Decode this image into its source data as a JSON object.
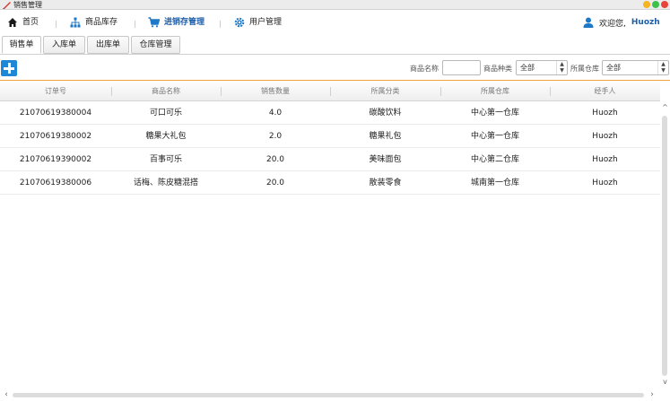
{
  "window": {
    "title": "销售管理",
    "controls": [
      "minimize",
      "maximize",
      "close"
    ],
    "control_colors": [
      "#f5b51e",
      "#3cc24a",
      "#e8443a"
    ]
  },
  "navbar": {
    "items": [
      {
        "label": "首页",
        "icon": "home-icon"
      },
      {
        "label": "商品库存",
        "icon": "sitemap-icon"
      },
      {
        "label": "进销存管理",
        "icon": "cart-icon",
        "active": true
      },
      {
        "label": "用户管理",
        "icon": "gear-icon"
      }
    ],
    "welcome_text": "欢迎您,",
    "username": "Huozh",
    "accent_color": "#1f5ea8"
  },
  "subtabs": [
    {
      "label": "销售单",
      "active": true
    },
    {
      "label": "入库单"
    },
    {
      "label": "出库单"
    },
    {
      "label": "仓库管理"
    }
  ],
  "filters": {
    "name_label": "商品名称",
    "name_value": "",
    "type_label": "商品种类",
    "type_value": "全部",
    "warehouse_label": "所属仓库",
    "warehouse_value": "全部"
  },
  "table": {
    "columns": [
      "订单号",
      "商品名称",
      "销售数量",
      "所属分类",
      "所属仓库",
      "经手人"
    ],
    "rows": [
      [
        "21070619380004",
        "可口可乐",
        "4.0",
        "碳酸饮料",
        "中心第一仓库",
        "Huozh"
      ],
      [
        "21070619380002",
        "糖果大礼包",
        "2.0",
        "糖果礼包",
        "中心第一仓库",
        "Huozh"
      ],
      [
        "21070619390002",
        "百事可乐",
        "20.0",
        "美味面包",
        "中心第二仓库",
        "Huozh"
      ],
      [
        "21070619380006",
        "话梅、陈皮糖混搭",
        "20.0",
        "散装零食",
        "城南第一仓库",
        "Huozh"
      ]
    ]
  }
}
